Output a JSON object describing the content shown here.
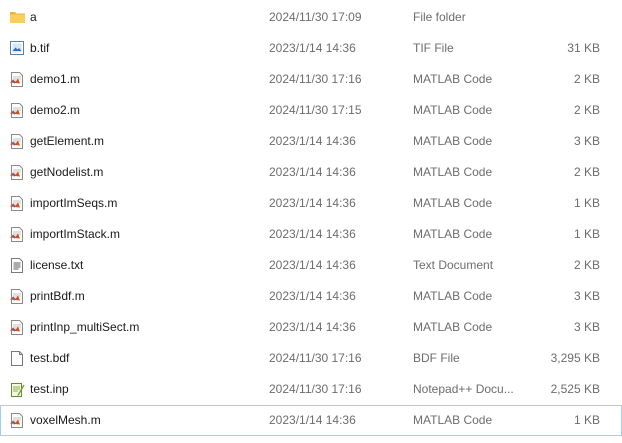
{
  "files": [
    {
      "name": "a",
      "date": "2024/11/30 17:09",
      "type": "File folder",
      "size": "",
      "icon": "folder-icon"
    },
    {
      "name": "b.tif",
      "date": "2023/1/14 14:36",
      "type": "TIF File",
      "size": "31 KB",
      "icon": "image-file-icon"
    },
    {
      "name": "demo1.m",
      "date": "2024/11/30 17:16",
      "type": "MATLAB Code",
      "size": "2 KB",
      "icon": "matlab-file-icon"
    },
    {
      "name": "demo2.m",
      "date": "2024/11/30 17:15",
      "type": "MATLAB Code",
      "size": "2 KB",
      "icon": "matlab-file-icon"
    },
    {
      "name": "getElement.m",
      "date": "2023/1/14 14:36",
      "type": "MATLAB Code",
      "size": "3 KB",
      "icon": "matlab-file-icon"
    },
    {
      "name": "getNodelist.m",
      "date": "2023/1/14 14:36",
      "type": "MATLAB Code",
      "size": "2 KB",
      "icon": "matlab-file-icon"
    },
    {
      "name": "importImSeqs.m",
      "date": "2023/1/14 14:36",
      "type": "MATLAB Code",
      "size": "1 KB",
      "icon": "matlab-file-icon"
    },
    {
      "name": "importImStack.m",
      "date": "2023/1/14 14:36",
      "type": "MATLAB Code",
      "size": "1 KB",
      "icon": "matlab-file-icon"
    },
    {
      "name": "license.txt",
      "date": "2023/1/14 14:36",
      "type": "Text Document",
      "size": "2 KB",
      "icon": "text-file-icon"
    },
    {
      "name": "printBdf.m",
      "date": "2023/1/14 14:36",
      "type": "MATLAB Code",
      "size": "3 KB",
      "icon": "matlab-file-icon"
    },
    {
      "name": "printInp_multiSect.m",
      "date": "2023/1/14 14:36",
      "type": "MATLAB Code",
      "size": "3 KB",
      "icon": "matlab-file-icon"
    },
    {
      "name": "test.bdf",
      "date": "2024/11/30 17:16",
      "type": "BDF File",
      "size": "3,295 KB",
      "icon": "blank-file-icon"
    },
    {
      "name": "test.inp",
      "date": "2024/11/30 17:16",
      "type": "Notepad++ Docu...",
      "size": "2,525 KB",
      "icon": "notepadpp-file-icon"
    },
    {
      "name": "voxelMesh.m",
      "date": "2023/1/14 14:36",
      "type": "MATLAB Code",
      "size": "1 KB",
      "icon": "matlab-file-icon"
    }
  ],
  "selected_index": 13
}
